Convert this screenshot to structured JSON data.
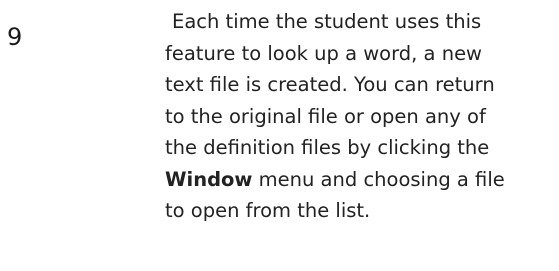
{
  "step": {
    "number": "9",
    "lines": [
      "Each time the student uses this",
      "feature to look up a word, a new",
      "text file is created. You can return",
      "to the original file or open any of",
      "the definition files by clicking the"
    ],
    "line6_bold": "Window",
    "line6_rest": " menu and choosing a file",
    "line7": "to open from the list."
  }
}
